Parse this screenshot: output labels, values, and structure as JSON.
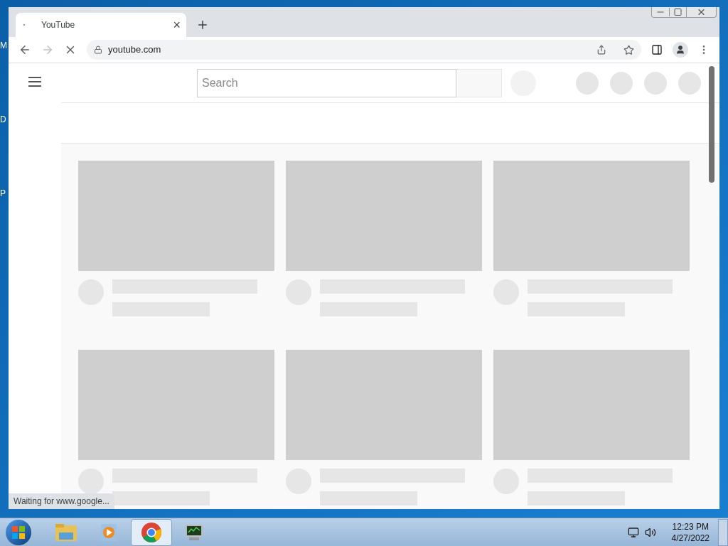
{
  "desktop": {
    "icon_labels": [
      "M",
      "D",
      "P"
    ]
  },
  "browser": {
    "tabs": [
      {
        "title": "YouTube",
        "close": "×",
        "selected": true
      }
    ],
    "address": "youtube.com",
    "page": {
      "search": {
        "placeholder": "Search"
      }
    },
    "status_bubble": "Waiting for www.google..."
  },
  "taskbar": {
    "apps": [
      {
        "kind": "explorer",
        "selected": false
      },
      {
        "kind": "media",
        "selected": false
      },
      {
        "kind": "chrome",
        "selected": true
      },
      {
        "kind": "monitor",
        "selected": false
      }
    ],
    "clock": {
      "time": "12:23 PM",
      "date": "4/27/2022"
    }
  }
}
